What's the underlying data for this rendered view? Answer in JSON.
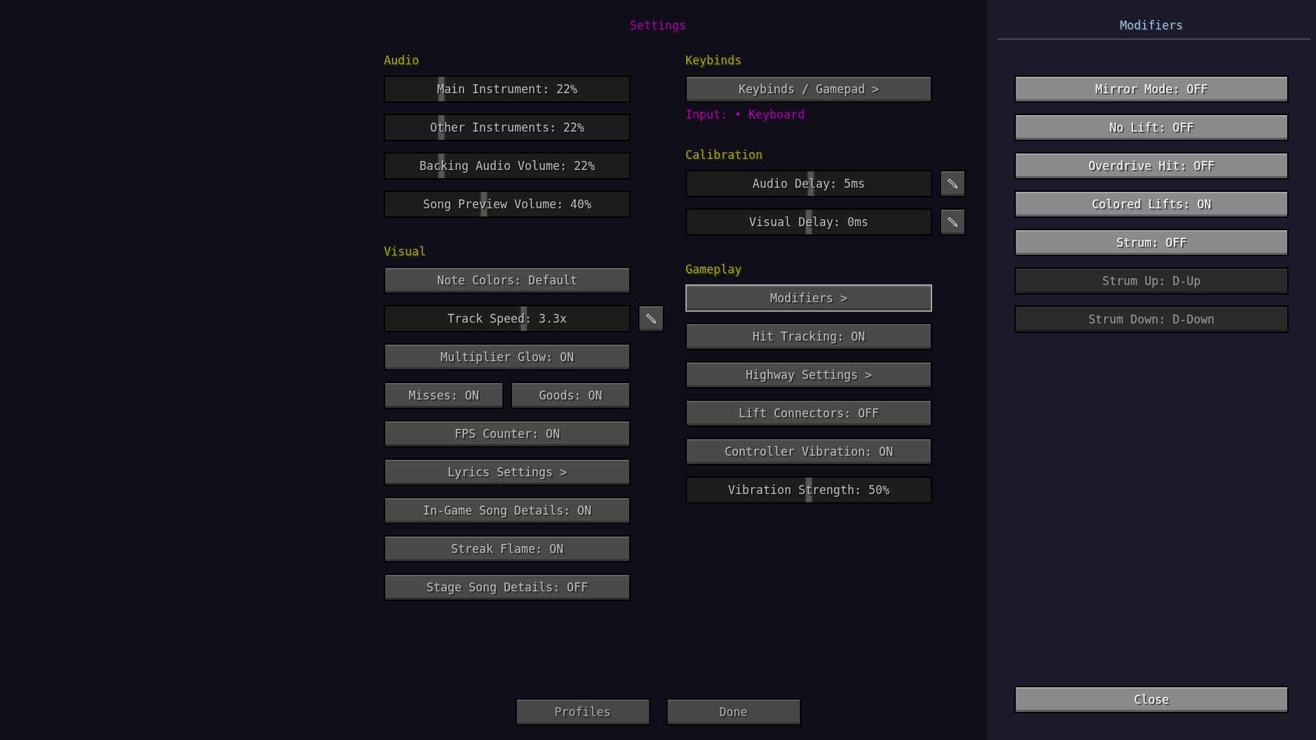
{
  "title": "Settings",
  "columns": [
    {
      "sections": [
        {
          "heading": "Audio",
          "items": [
            {
              "kind": "slider",
              "label": "Main Instrument: 22%",
              "level": 0.22
            },
            {
              "kind": "slider",
              "label": "Other Instruments: 22%",
              "level": 0.22
            },
            {
              "kind": "slider",
              "label": "Backing Audio Volume: 22%",
              "level": 0.22
            },
            {
              "kind": "slider",
              "label": "Song Preview Volume: 40%",
              "level": 0.4
            }
          ]
        },
        {
          "heading": "Visual",
          "items": [
            {
              "kind": "button",
              "label": "Note Colors: Default"
            },
            {
              "kind": "slider",
              "label": "Track Speed: 3.3x",
              "level": 0.57,
              "editable": true
            },
            {
              "kind": "button",
              "label": "Multiplier Glow: ON"
            },
            {
              "kind": "pair",
              "labels": [
                "Misses: ON",
                "Goods: ON"
              ]
            },
            {
              "kind": "button",
              "label": "FPS Counter: ON"
            },
            {
              "kind": "button",
              "label": "Lyrics Settings >"
            },
            {
              "kind": "button",
              "label": "In-Game Song Details: ON"
            },
            {
              "kind": "button",
              "label": "Streak Flame: ON"
            },
            {
              "kind": "button",
              "label": "Stage Song Details: OFF"
            }
          ]
        }
      ]
    },
    {
      "sections": [
        {
          "heading": "Keybinds",
          "items": [
            {
              "kind": "button",
              "label": "Keybinds / Gamepad >"
            },
            {
              "kind": "note",
              "label": "Input: • Keyboard"
            }
          ]
        },
        {
          "heading": "Calibration",
          "items": [
            {
              "kind": "slider",
              "label": "Audio Delay: 5ms",
              "level": 0.51,
              "editable": true
            },
            {
              "kind": "slider",
              "label": "Visual Delay: 0ms",
              "level": 0.5,
              "editable": true
            }
          ]
        },
        {
          "heading": "Gameplay",
          "items": [
            {
              "kind": "button",
              "label": "Modifiers >",
              "selected": true
            },
            {
              "kind": "button",
              "label": "Hit Tracking: ON",
              "selected": false
            },
            {
              "kind": "button",
              "label": "Highway Settings >",
              "selected": false
            },
            {
              "kind": "button",
              "label": "Lift Connectors: OFF",
              "selected": false
            },
            {
              "kind": "button",
              "label": "Controller Vibration: ON",
              "selected": false
            },
            {
              "kind": "slider",
              "label": "Vibration Strength: 50%",
              "level": 0.5,
              "selected": false
            }
          ]
        }
      ]
    }
  ],
  "footer_buttons": [
    "Profiles",
    "Done"
  ],
  "modifiers_panel": {
    "title": "Modifiers",
    "items": [
      {
        "label": "Mirror Mode: OFF",
        "disabled": false
      },
      {
        "label": "No Lift: OFF",
        "disabled": false
      },
      {
        "label": "Overdrive Hit: OFF",
        "disabled": false
      },
      {
        "label": "Colored Lifts: ON",
        "disabled": false
      },
      {
        "label": "Strum: OFF",
        "disabled": false
      },
      {
        "label": "Strum Up: D-Up",
        "disabled": true
      },
      {
        "label": "Strum Down: D-Down",
        "disabled": true
      }
    ],
    "close": "Close"
  }
}
